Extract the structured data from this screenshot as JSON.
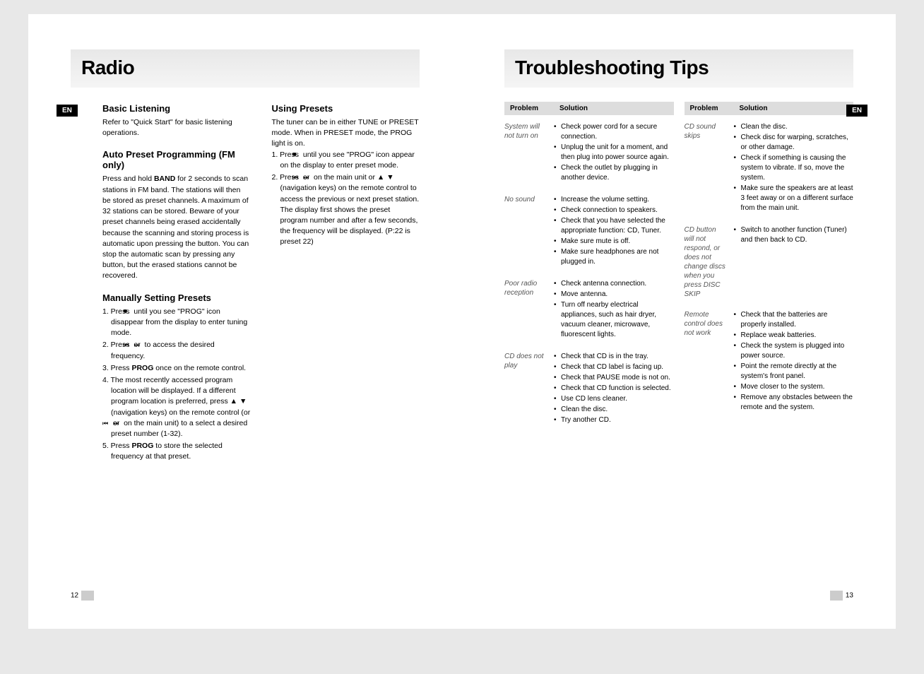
{
  "left": {
    "title": "Radio",
    "lang_badge": "EN",
    "page_num": "12",
    "col1": {
      "h_basic": "Basic Listening",
      "basic_text": "Refer to \"Quick Start\" for basic listening operations.",
      "h_auto": "Auto Preset Programming (FM only)",
      "auto_text": "Press and hold BAND for 2 seconds to scan stations in FM band. The stations will then be stored as preset channels. A maximum of 32 stations can be stored. Beware of your preset channels being erased accidentally because the scanning and storing process is automatic upon pressing the button. You can stop the automatic scan by pressing any button, but the erased stations cannot be recovered.",
      "h_manual": "Manually Setting Presets",
      "m1a": "1. Press ",
      "m1b": " until you see \"PROG\" icon disappear from the display to enter tuning mode.",
      "m2a": "2. Press ",
      "m2b": " or ",
      "m2c": " to access the desired frequency.",
      "m3": "3. Press PROG once on the remote control.",
      "m4a": "4. The most recently accessed program location will be displayed. If a different program location is preferred, press ▲ ▼ (navigation keys) on the remote control (or ",
      "m4b": " or ",
      "m4c": " on the main unit) to a select a desired preset number (1-32).",
      "m5": "5. Press PROG to store the selected frequency at that preset."
    },
    "col2": {
      "h_using": "Using Presets",
      "using_text": "The tuner can be in either TUNE or PRESET mode. When in PRESET mode, the PROG light is on.",
      "u1a": "1. Press ",
      "u1b": " until you see \"PROG\" icon appear on the display to enter preset mode.",
      "u2a": "2. Press ",
      "u2b": " or ",
      "u2c": " on the main unit or ▲ ▼ (navigation keys) on the remote control to access the previous or next preset station. The display first shows the preset program number and after a few seconds, the frequency will be displayed.  (P:22 is preset 22)"
    }
  },
  "right": {
    "title": "Troubleshooting Tips",
    "lang_badge": "EN",
    "page_num": "13",
    "header_problem": "Problem",
    "header_solution": "Solution",
    "problems_left": [
      {
        "label": "System will not turn on",
        "solutions": [
          "Check power cord for a secure connection.",
          "Unplug the unit for a moment, and then plug into power source again.",
          "Check the outlet by plugging in another device."
        ]
      },
      {
        "label": "No sound",
        "solutions": [
          "Increase the volume setting.",
          "Check connection to speakers.",
          "Check that you have selected the appropriate function: CD, Tuner.",
          "Make sure mute is off.",
          "Make sure headphones are not plugged in."
        ]
      },
      {
        "label": "Poor radio reception",
        "solutions": [
          "Check antenna connection.",
          "Move antenna.",
          "Turn off nearby electrical appliances, such as hair dryer, vacuum cleaner, microwave, fluorescent lights."
        ]
      },
      {
        "label": "CD does not play",
        "solutions": [
          "Check that CD is in the tray.",
          "Check that CD label is facing up.",
          "Check that PAUSE mode is not on.",
          "Check that CD function is selected.",
          "Use CD lens cleaner.",
          "Clean the disc.",
          "Try another CD."
        ]
      }
    ],
    "problems_right": [
      {
        "label": "CD sound skips",
        "solutions": [
          "Clean the disc.",
          "Check disc for warping, scratches, or other damage.",
          "Check if something is causing the system to  vibrate. If so, move the  system.",
          "Make sure the speakers are at least 3 feet away or on a different surface from the main unit."
        ]
      },
      {
        "label": "CD button will not respond, or does not change discs when you press DISC SKIP",
        "solutions": [
          "Switch to another function (Tuner) and then back to CD."
        ]
      },
      {
        "label": "Remote control does not work",
        "solutions": [
          "Check that the batteries are properly installed.",
          "Replace weak batteries.",
          "Check the system is plugged into power source.",
          "Point the remote directly at the system's front panel.",
          "Move closer to the system.",
          "Remove any obstacles between the remote and the system."
        ]
      }
    ]
  }
}
